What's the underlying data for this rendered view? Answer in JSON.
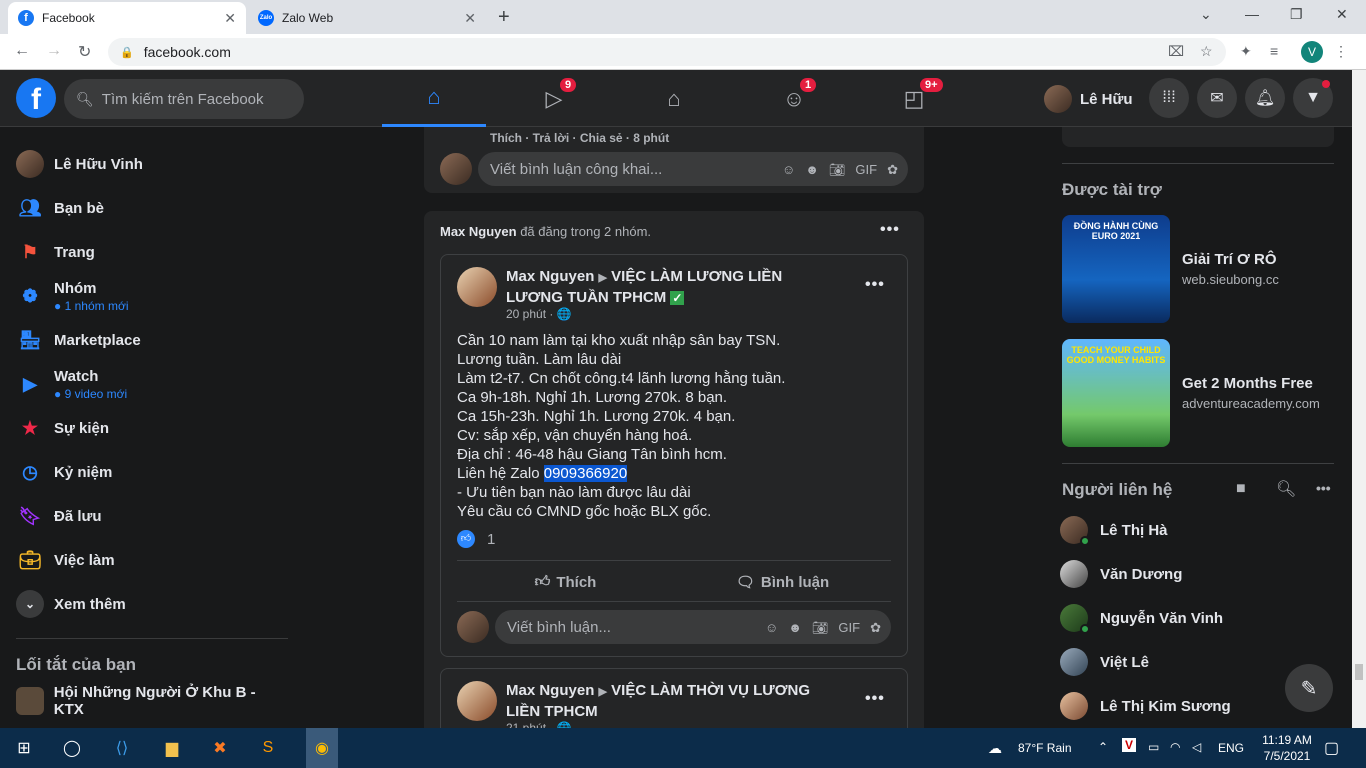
{
  "browser": {
    "tabs": [
      {
        "label": "Facebook",
        "close": "✕"
      },
      {
        "label": "Zalo Web",
        "close": "✕"
      }
    ],
    "url": "facebook.com",
    "profile_initial": "V"
  },
  "fb_header": {
    "logo": "f",
    "search_placeholder": "Tìm kiếm trên Facebook",
    "nav": [
      {
        "name": "home",
        "badge": ""
      },
      {
        "name": "watch",
        "badge": "9"
      },
      {
        "name": "marketplace",
        "badge": ""
      },
      {
        "name": "groups",
        "badge": "1"
      },
      {
        "name": "gaming",
        "badge": "9+"
      }
    ],
    "user_name": "Lê Hữu"
  },
  "left_nav": {
    "items": [
      {
        "label": "Lê Hữu Vinh",
        "sub": ""
      },
      {
        "label": "Bạn bè",
        "sub": ""
      },
      {
        "label": "Trang",
        "sub": ""
      },
      {
        "label": "Nhóm",
        "sub": "1 nhóm mới"
      },
      {
        "label": "Marketplace",
        "sub": ""
      },
      {
        "label": "Watch",
        "sub": "9 video mới"
      },
      {
        "label": "Sự kiện",
        "sub": ""
      },
      {
        "label": "Kỷ niệm",
        "sub": ""
      },
      {
        "label": "Đã lưu",
        "sub": ""
      },
      {
        "label": "Việc làm",
        "sub": ""
      },
      {
        "label": "Xem thêm",
        "sub": ""
      }
    ],
    "shortcuts_heading": "Lối tắt của bạn",
    "shortcut_1": "Hội Những Người Ở Khu B - KTX"
  },
  "feed": {
    "top_card": {
      "actions": "Thích · Trả lời · Chia sẻ · 8 phút",
      "comment_placeholder": "Viết bình luận công khai..."
    },
    "share_card": {
      "header_name": "Max Nguyen",
      "header_rest": " đã đăng trong 2 nhóm.",
      "post1": {
        "author": "Max Nguyen",
        "group": "VIỆC LÀM LƯƠNG LIỀN LƯƠNG TUẦN TPHCM",
        "time": "20 phút · 🌐",
        "lines": [
          "Cần 10 nam làm tại kho xuất nhập sân bay TSN.",
          "Lương tuần. Làm lâu dài",
          "Làm t2-t7. Cn chốt công.t4 lãnh lương hằng tuần.",
          "Ca 9h-18h. Nghỉ 1h. Lương 270k. 8 bạn.",
          "Ca 15h-23h. Nghỉ 1h. Lương 270k. 4 bạn.",
          "Cv: sắp xếp, vận chuyển hàng hoá.",
          "Địa chỉ : 46-48 hậu Giang Tân bình hcm."
        ],
        "zalo_prefix": "Liên hệ Zalo ",
        "zalo_phone": "0909366920",
        "lines2": [
          "- Ưu tiên bạn nào làm được lâu dài",
          "Yêu cầu có CMND gốc hoặc BLX gốc."
        ],
        "like_count": "1",
        "like_label": "Thích",
        "comment_label": "Bình luận",
        "comment_placeholder": "Viết bình luận..."
      },
      "post2": {
        "author": "Max Nguyen",
        "group": "VIỆC LÀM THỜI VỤ LƯƠNG LIỀN TPHCM",
        "time": "21 phút · 🌐"
      }
    }
  },
  "right_col": {
    "sponsored_heading": "Được tài trợ",
    "ads": [
      {
        "title": "Giải Trí Ơ RÔ",
        "url": "web.sieubong.cc",
        "img_text": "ĐỒNG HÀNH CÙNG EURO 2021"
      },
      {
        "title": "Get 2 Months Free",
        "url": "adventureacademy.com",
        "img_text": "TEACH YOUR CHILD GOOD MONEY HABITS"
      }
    ],
    "contacts_heading": "Người liên hệ",
    "contacts": [
      "Lê Thị Hà",
      "Văn Dương",
      "Nguyễn Văn Vinh",
      "Việt Lê",
      "Lê Thị Kim Sương"
    ]
  },
  "taskbar": {
    "weather": "87°F  Rain",
    "lang": "ENG",
    "time": "11:19 AM",
    "date": "7/5/2021"
  }
}
